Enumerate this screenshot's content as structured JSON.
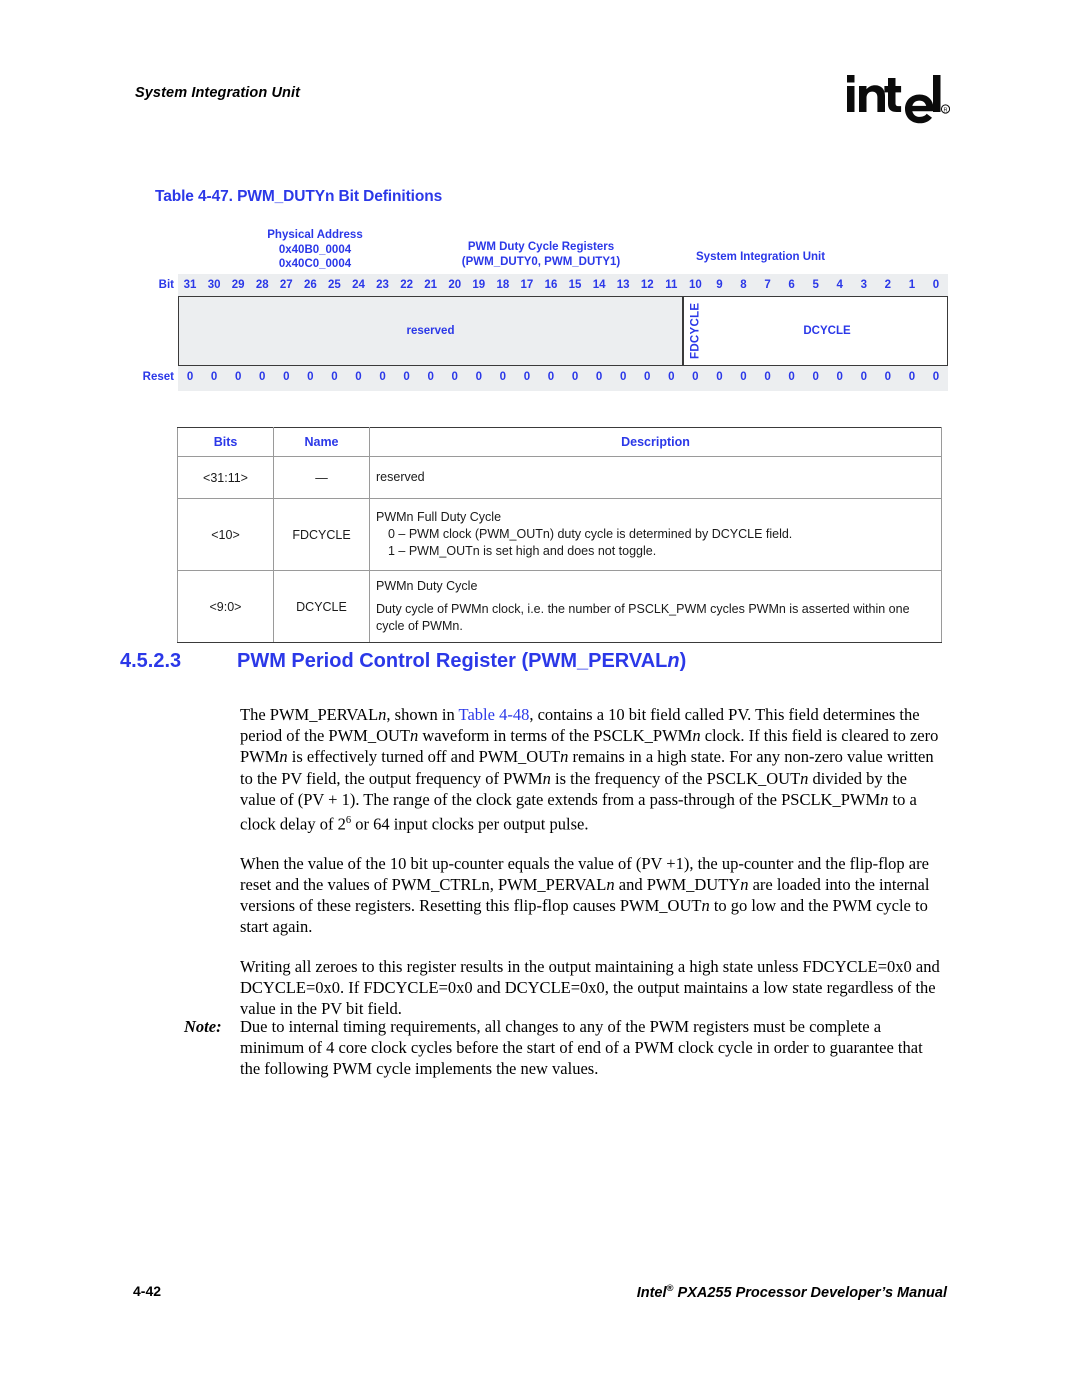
{
  "header": {
    "running_head": "System Integration Unit",
    "logo_text": "intel",
    "logo_mark": "®"
  },
  "table_caption": "Table 4-47. PWM_DUTYn Bit Definitions",
  "register_diagram": {
    "physical_address_label": "Physical Address",
    "physical_address_1": "0x40B0_0004",
    "physical_address_2": "0x40C0_0004",
    "register_name_label": "PWM Duty Cycle Registers",
    "register_name_detail": "(PWM_DUTY0, PWM_DUTY1)",
    "unit_label": "System Integration Unit",
    "bit_row_label": "Bit",
    "reset_row_label": "Reset",
    "bits": [
      "31",
      "30",
      "29",
      "28",
      "27",
      "26",
      "25",
      "24",
      "23",
      "22",
      "21",
      "20",
      "19",
      "18",
      "17",
      "16",
      "15",
      "14",
      "13",
      "12",
      "11",
      "10",
      "9",
      "8",
      "7",
      "6",
      "5",
      "4",
      "3",
      "2",
      "1",
      "0"
    ],
    "reset_values": [
      "0",
      "0",
      "0",
      "0",
      "0",
      "0",
      "0",
      "0",
      "0",
      "0",
      "0",
      "0",
      "0",
      "0",
      "0",
      "0",
      "0",
      "0",
      "0",
      "0",
      "0",
      "0",
      "0",
      "0",
      "0",
      "0",
      "0",
      "0",
      "0",
      "0",
      "0",
      "0"
    ],
    "fields": [
      {
        "label": "reserved",
        "span": 21,
        "shaded": true
      },
      {
        "label": "FDCYCLE",
        "span": 1,
        "shaded": false
      },
      {
        "label": "DCYCLE",
        "span": 10,
        "shaded": false
      }
    ]
  },
  "definitions_table": {
    "headers": {
      "bits": "Bits",
      "name": "Name",
      "description": "Description"
    },
    "rows": [
      {
        "bits": "<31:11>",
        "name": "—",
        "desc_title": "reserved",
        "desc_lines": [],
        "desc_para": ""
      },
      {
        "bits": "<10>",
        "name": "FDCYCLE",
        "desc_title": "PWMn Full Duty Cycle",
        "desc_lines": [
          "0 – PWM clock (PWM_OUTn) duty cycle is determined by DCYCLE field.",
          "1 – PWM_OUTn is set high and does not toggle."
        ],
        "desc_para": ""
      },
      {
        "bits": "<9:0>",
        "name": "DCYCLE",
        "desc_title": "PWMn Duty Cycle",
        "desc_lines": [],
        "desc_para": "Duty cycle of PWMn clock, i.e. the number of PSCLK_PWM cycles PWMn is asserted within one cycle of PWMn."
      }
    ]
  },
  "section": {
    "number": "4.5.2.3",
    "title_main": "PWM Period Control Register (PWM_PERVAL",
    "title_italic": "n",
    "title_end": ")"
  },
  "paragraphs": {
    "p1_a": "The PWM_PERVAL",
    "p1_b": ", shown in ",
    "p1_link": "Table 4-48",
    "p1_c": ", contains a 10 bit field called PV. This field determines the period of the PWM_OUT",
    "p1_d": " waveform in terms of the PSCLK_PWM",
    "p1_e": " clock. If this field is cleared to zero PWM",
    "p1_f": " is effectively turned off and PWM_OUT",
    "p1_g": " remains in a high state. For any non-zero value written to the PV field, the output frequency of PWM",
    "p1_h": " is the frequency of the PSCLK_OUT",
    "p1_i": " divided by the value of (PV + 1). The range of the clock gate extends from a pass-through of the PSCLK_PWM",
    "p1_j": " to a clock delay of 2",
    "p1_sup": "6",
    "p1_k": " or 64 input clocks per output pulse.",
    "p2_a": "When the value of the 10 bit up-counter equals the value of (PV +1), the up-counter and the flip-flop are reset and the values of PWM_CTRLn, PWM_PERVAL",
    "p2_b": " and PWM_DUTY",
    "p2_c": " are loaded into the internal versions of these registers. Resetting this flip-flop causes PWM_OUT",
    "p2_d": " to go low and the PWM cycle to start again.",
    "p3": "Writing all zeroes to this register results in the output maintaining a high state unless FDCYCLE=0x0 and DCYCLE=0x0. If FDCYCLE=0x0 and DCYCLE=0x0, the output maintains a low state regardless of the value in the PV bit field.",
    "italic_n": "n"
  },
  "note": {
    "label": "Note:",
    "text": "Due to internal timing requirements, all changes to any of the PWM registers must be complete a minimum of 4 core clock cycles before the start of end of a PWM clock cycle in order to guarantee that the following PWM cycle implements the new values."
  },
  "footer": {
    "page_number": "4-42",
    "manual_prefix": "Intel",
    "manual_mark": "®",
    "manual_title": " PXA255 Processor Developer’s Manual"
  },
  "colors": {
    "accent_blue": "#2b38e8",
    "shaded_field": "#eceef0",
    "strip_bg": "#eceef0",
    "border_dark": "#3a3a3a",
    "border_light": "#9a9a9a"
  }
}
